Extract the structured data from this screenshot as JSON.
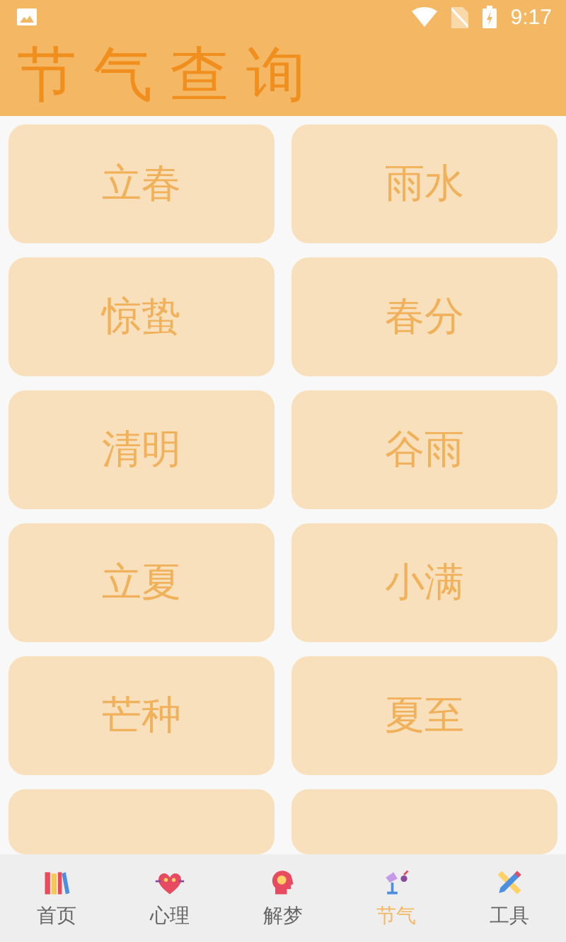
{
  "status_bar": {
    "time": "9:17"
  },
  "header": {
    "title": "节气查询"
  },
  "terms": [
    {
      "kind": "term",
      "label": "立春"
    },
    {
      "kind": "term",
      "label": "雨水"
    },
    {
      "kind": "term",
      "label": "惊蛰"
    },
    {
      "kind": "term",
      "label": "春分"
    },
    {
      "kind": "term",
      "label": "清明"
    },
    {
      "kind": "term",
      "label": "谷雨"
    },
    {
      "kind": "term",
      "label": "立夏"
    },
    {
      "kind": "term",
      "label": "小满"
    },
    {
      "kind": "term",
      "label": "芒种"
    },
    {
      "kind": "term",
      "label": "夏至"
    },
    {
      "kind": "cut"
    },
    {
      "kind": "cut"
    }
  ],
  "nav": [
    {
      "label": "首页",
      "kind": "books",
      "selected": false
    },
    {
      "label": "心理",
      "kind": "heart",
      "selected": false
    },
    {
      "label": "解梦",
      "kind": "head",
      "selected": false
    },
    {
      "label": "节气",
      "kind": "kite",
      "selected": true
    },
    {
      "label": "工具",
      "kind": "tools",
      "selected": false
    }
  ]
}
